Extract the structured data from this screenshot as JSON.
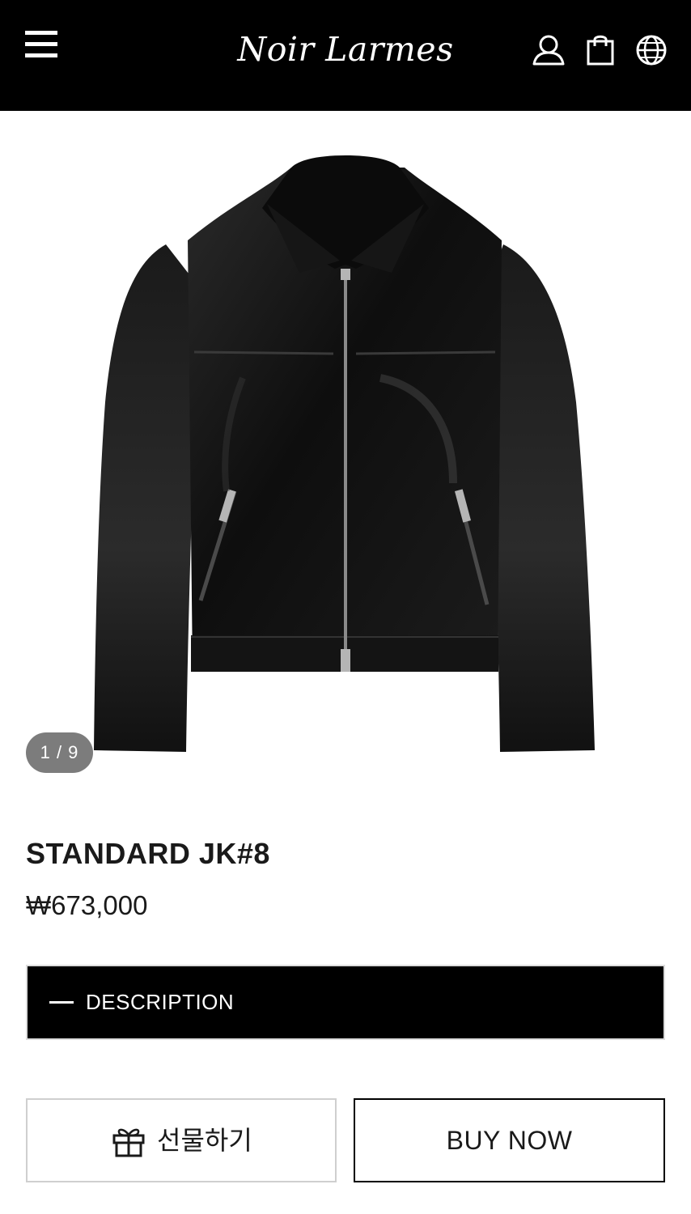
{
  "header": {
    "brand": "Noir Larmes",
    "icons": [
      "menu-icon",
      "user-icon",
      "bag-icon",
      "globe-icon"
    ]
  },
  "gallery": {
    "counter": "1 / 9"
  },
  "product": {
    "title": "STANDARD JK#8",
    "price": "₩673,000"
  },
  "accordion": {
    "label": "DESCRIPTION"
  },
  "actions": {
    "gift_label": "선물하기",
    "buy_label": "BUY NOW"
  },
  "colors": {
    "header_bg": "#000000",
    "counter_bg": "#7c7c7c",
    "text": "#1a1a1a"
  }
}
